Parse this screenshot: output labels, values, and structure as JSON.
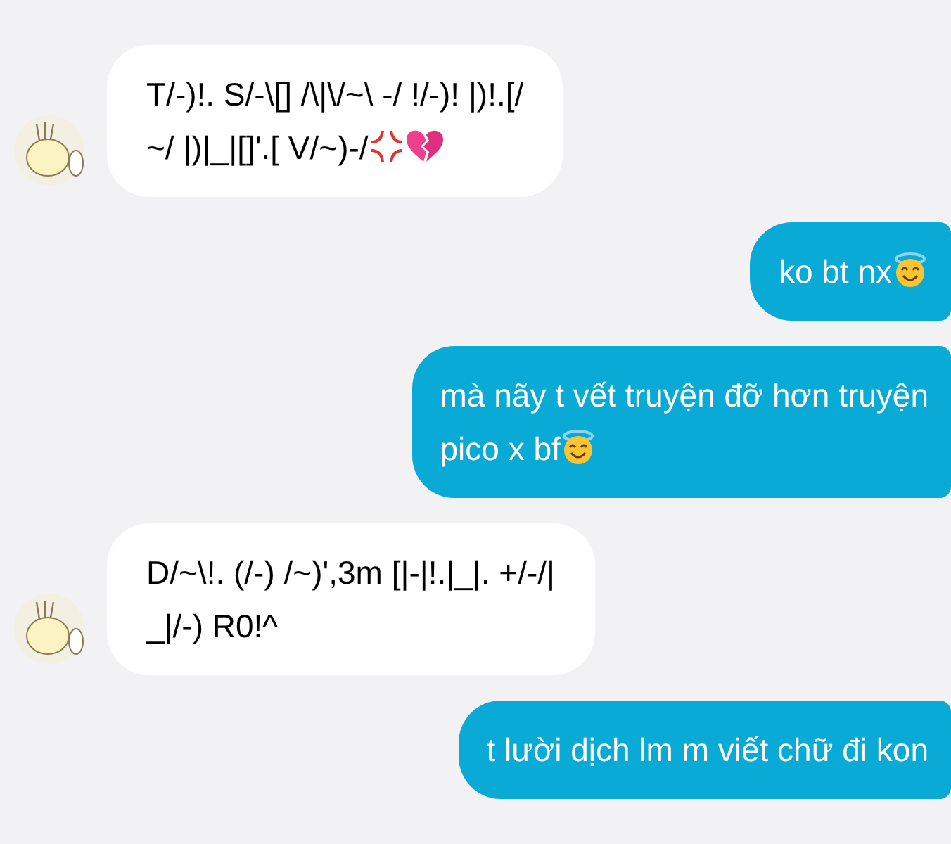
{
  "messages": [
    {
      "kind": "incoming",
      "text": "T/-)!. S/-\\[] /\\|\\/~\\ -/ !/-)! |)!.[/\n~/ |)|_|[]'.[ V/~)-/",
      "end_icons": [
        {
          "kind": "anger"
        },
        {
          "kind": "broken-heart"
        }
      ]
    },
    {
      "kind": "outgoing",
      "text": "ko bt nx",
      "end_icons": [
        {
          "kind": "halo-smile"
        }
      ]
    },
    {
      "kind": "outgoing",
      "text": "mà nãy t vết truyện đỡ hơn truyện\npico x bf",
      "end_icons": [
        {
          "kind": "halo-smile"
        }
      ]
    },
    {
      "kind": "incoming",
      "text": "D/~\\!. (/-) /~)',3m [|-|!.|_|. +/-/|\n_|/-) R0!^"
    },
    {
      "kind": "outgoing",
      "text": "t lười dịch lm m viết chữ đi kon"
    }
  ]
}
